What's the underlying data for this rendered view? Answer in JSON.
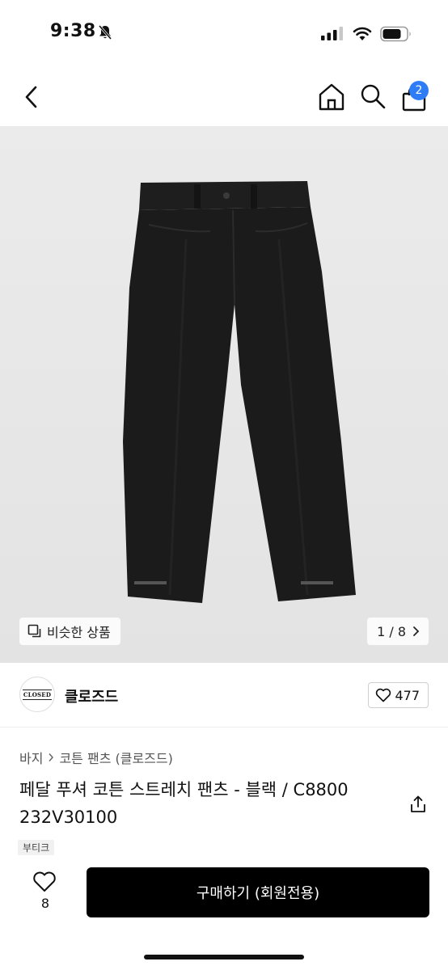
{
  "status_bar": {
    "time": "9:38",
    "icons": [
      "bell-slash-icon",
      "cellular-signal-icon",
      "wifi-icon",
      "battery-icon"
    ]
  },
  "nav": {
    "icons": [
      "back-chevron-icon",
      "home-icon",
      "search-icon",
      "shopping-bag-icon"
    ],
    "cart_badge": "2",
    "accent_color": "#2f7df6"
  },
  "gallery": {
    "similar_label": "비슷한 상품",
    "page_indicator": "1 / 8",
    "product_color": "#1b1b1b"
  },
  "brand": {
    "logo_text": "CLOSED",
    "name": "클로즈드",
    "like_count": "477"
  },
  "breadcrumb": {
    "category": "바지",
    "subcategory": "코튼 팬츠 (클로즈드)"
  },
  "product": {
    "title": "페달 푸셔 코튼 스트레치 팬츠 - 블랙 / C8800 232V30100",
    "tag": "부티크"
  },
  "bottom_bar": {
    "wish_count": "8",
    "buy_label": "구매하기 (회원전용)"
  }
}
